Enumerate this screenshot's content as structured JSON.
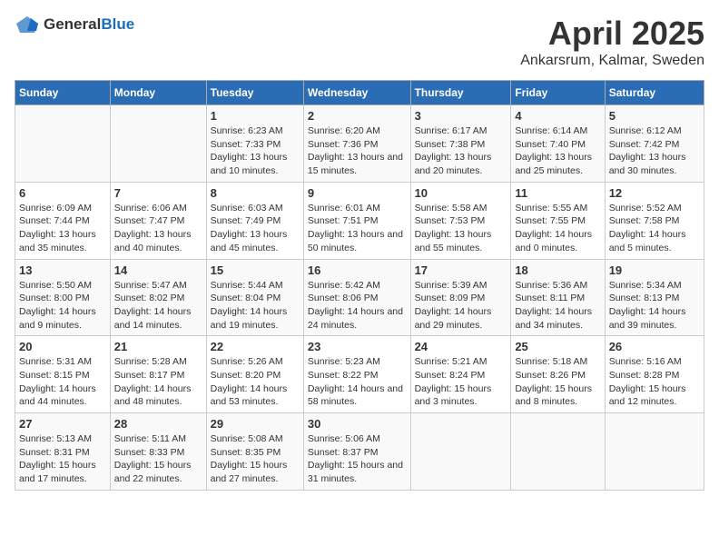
{
  "logo": {
    "general": "General",
    "blue": "Blue"
  },
  "header": {
    "title": "April 2025",
    "subtitle": "Ankarsrum, Kalmar, Sweden"
  },
  "weekdays": [
    "Sunday",
    "Monday",
    "Tuesday",
    "Wednesday",
    "Thursday",
    "Friday",
    "Saturday"
  ],
  "weeks": [
    [
      {
        "day": "",
        "empty": true
      },
      {
        "day": "",
        "empty": true
      },
      {
        "day": "1",
        "sunrise": "Sunrise: 6:23 AM",
        "sunset": "Sunset: 7:33 PM",
        "daylight": "Daylight: 13 hours and 10 minutes."
      },
      {
        "day": "2",
        "sunrise": "Sunrise: 6:20 AM",
        "sunset": "Sunset: 7:36 PM",
        "daylight": "Daylight: 13 hours and 15 minutes."
      },
      {
        "day": "3",
        "sunrise": "Sunrise: 6:17 AM",
        "sunset": "Sunset: 7:38 PM",
        "daylight": "Daylight: 13 hours and 20 minutes."
      },
      {
        "day": "4",
        "sunrise": "Sunrise: 6:14 AM",
        "sunset": "Sunset: 7:40 PM",
        "daylight": "Daylight: 13 hours and 25 minutes."
      },
      {
        "day": "5",
        "sunrise": "Sunrise: 6:12 AM",
        "sunset": "Sunset: 7:42 PM",
        "daylight": "Daylight: 13 hours and 30 minutes."
      }
    ],
    [
      {
        "day": "6",
        "sunrise": "Sunrise: 6:09 AM",
        "sunset": "Sunset: 7:44 PM",
        "daylight": "Daylight: 13 hours and 35 minutes."
      },
      {
        "day": "7",
        "sunrise": "Sunrise: 6:06 AM",
        "sunset": "Sunset: 7:47 PM",
        "daylight": "Daylight: 13 hours and 40 minutes."
      },
      {
        "day": "8",
        "sunrise": "Sunrise: 6:03 AM",
        "sunset": "Sunset: 7:49 PM",
        "daylight": "Daylight: 13 hours and 45 minutes."
      },
      {
        "day": "9",
        "sunrise": "Sunrise: 6:01 AM",
        "sunset": "Sunset: 7:51 PM",
        "daylight": "Daylight: 13 hours and 50 minutes."
      },
      {
        "day": "10",
        "sunrise": "Sunrise: 5:58 AM",
        "sunset": "Sunset: 7:53 PM",
        "daylight": "Daylight: 13 hours and 55 minutes."
      },
      {
        "day": "11",
        "sunrise": "Sunrise: 5:55 AM",
        "sunset": "Sunset: 7:55 PM",
        "daylight": "Daylight: 14 hours and 0 minutes."
      },
      {
        "day": "12",
        "sunrise": "Sunrise: 5:52 AM",
        "sunset": "Sunset: 7:58 PM",
        "daylight": "Daylight: 14 hours and 5 minutes."
      }
    ],
    [
      {
        "day": "13",
        "sunrise": "Sunrise: 5:50 AM",
        "sunset": "Sunset: 8:00 PM",
        "daylight": "Daylight: 14 hours and 9 minutes."
      },
      {
        "day": "14",
        "sunrise": "Sunrise: 5:47 AM",
        "sunset": "Sunset: 8:02 PM",
        "daylight": "Daylight: 14 hours and 14 minutes."
      },
      {
        "day": "15",
        "sunrise": "Sunrise: 5:44 AM",
        "sunset": "Sunset: 8:04 PM",
        "daylight": "Daylight: 14 hours and 19 minutes."
      },
      {
        "day": "16",
        "sunrise": "Sunrise: 5:42 AM",
        "sunset": "Sunset: 8:06 PM",
        "daylight": "Daylight: 14 hours and 24 minutes."
      },
      {
        "day": "17",
        "sunrise": "Sunrise: 5:39 AM",
        "sunset": "Sunset: 8:09 PM",
        "daylight": "Daylight: 14 hours and 29 minutes."
      },
      {
        "day": "18",
        "sunrise": "Sunrise: 5:36 AM",
        "sunset": "Sunset: 8:11 PM",
        "daylight": "Daylight: 14 hours and 34 minutes."
      },
      {
        "day": "19",
        "sunrise": "Sunrise: 5:34 AM",
        "sunset": "Sunset: 8:13 PM",
        "daylight": "Daylight: 14 hours and 39 minutes."
      }
    ],
    [
      {
        "day": "20",
        "sunrise": "Sunrise: 5:31 AM",
        "sunset": "Sunset: 8:15 PM",
        "daylight": "Daylight: 14 hours and 44 minutes."
      },
      {
        "day": "21",
        "sunrise": "Sunrise: 5:28 AM",
        "sunset": "Sunset: 8:17 PM",
        "daylight": "Daylight: 14 hours and 48 minutes."
      },
      {
        "day": "22",
        "sunrise": "Sunrise: 5:26 AM",
        "sunset": "Sunset: 8:20 PM",
        "daylight": "Daylight: 14 hours and 53 minutes."
      },
      {
        "day": "23",
        "sunrise": "Sunrise: 5:23 AM",
        "sunset": "Sunset: 8:22 PM",
        "daylight": "Daylight: 14 hours and 58 minutes."
      },
      {
        "day": "24",
        "sunrise": "Sunrise: 5:21 AM",
        "sunset": "Sunset: 8:24 PM",
        "daylight": "Daylight: 15 hours and 3 minutes."
      },
      {
        "day": "25",
        "sunrise": "Sunrise: 5:18 AM",
        "sunset": "Sunset: 8:26 PM",
        "daylight": "Daylight: 15 hours and 8 minutes."
      },
      {
        "day": "26",
        "sunrise": "Sunrise: 5:16 AM",
        "sunset": "Sunset: 8:28 PM",
        "daylight": "Daylight: 15 hours and 12 minutes."
      }
    ],
    [
      {
        "day": "27",
        "sunrise": "Sunrise: 5:13 AM",
        "sunset": "Sunset: 8:31 PM",
        "daylight": "Daylight: 15 hours and 17 minutes."
      },
      {
        "day": "28",
        "sunrise": "Sunrise: 5:11 AM",
        "sunset": "Sunset: 8:33 PM",
        "daylight": "Daylight: 15 hours and 22 minutes."
      },
      {
        "day": "29",
        "sunrise": "Sunrise: 5:08 AM",
        "sunset": "Sunset: 8:35 PM",
        "daylight": "Daylight: 15 hours and 27 minutes."
      },
      {
        "day": "30",
        "sunrise": "Sunrise: 5:06 AM",
        "sunset": "Sunset: 8:37 PM",
        "daylight": "Daylight: 15 hours and 31 minutes."
      },
      {
        "day": "",
        "empty": true
      },
      {
        "day": "",
        "empty": true
      },
      {
        "day": "",
        "empty": true
      }
    ]
  ]
}
